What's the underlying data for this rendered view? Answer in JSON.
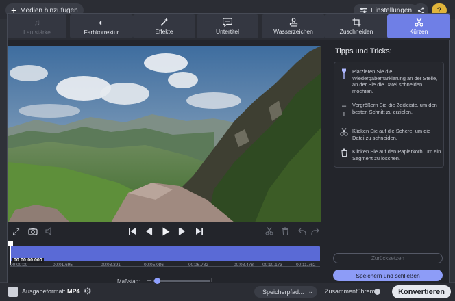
{
  "main_window": {
    "add_media_label": "Medien hinzufügen",
    "settings_label": "Einstellungen",
    "help_label": "?",
    "output_format_label": "Ausgabeformat:",
    "output_format_value": "MP4",
    "save_path_label": "Speicherpfad...",
    "merge_label": "Zusammenführen:",
    "convert_label": "Konvertieren"
  },
  "tabs": [
    {
      "label": "Lautstärke",
      "icon": "music-note-icon",
      "state": "disabled"
    },
    {
      "label": "Farbkorrektur",
      "icon": "color-correction-icon",
      "state": "normal"
    },
    {
      "label": "Effekte",
      "icon": "magic-wand-icon",
      "state": "normal"
    },
    {
      "label": "Untertitel",
      "icon": "subtitle-icon",
      "state": "normal"
    },
    {
      "label": "Wasserzeichen",
      "icon": "stamp-icon",
      "state": "normal"
    },
    {
      "label": "Zuschneiden",
      "icon": "crop-icon",
      "state": "normal"
    },
    {
      "label": "Kürzen",
      "icon": "scissors-icon",
      "state": "active"
    }
  ],
  "timeline": {
    "current_time": "00:00:00.000",
    "ticks": [
      "00:00:00",
      "00:01.695",
      "00:03.391",
      "00:05.086",
      "00:06.782",
      "00:08.478",
      "00:10.173",
      "00:11.762"
    ],
    "scale_label": "Maßstab:",
    "scale_minus": "–",
    "scale_plus": "+",
    "scale_level": 0.02
  },
  "tips": {
    "title": "Tipps und Tricks:",
    "items": [
      {
        "icon": "marker-icon",
        "text": "Platzieren Sie die Wiedergabemarkierung an der Stelle, an der Sie die Datei schneiden möchten."
      },
      {
        "icon": "zoom-timeline-icon",
        "text": "Vergrößern Sie die Zeitleiste, um den besten Schnitt zu erzielen."
      },
      {
        "icon": "scissors-icon",
        "text": "Klicken Sie auf die Schere, um die Datei zu schneiden."
      },
      {
        "icon": "trash-icon",
        "text": "Klicken Sie auf den Papierkorb, um ein Segment zu löschen."
      }
    ]
  },
  "buttons": {
    "reset_label": "Zurücksetzen",
    "save_close_label": "Speichern und schließen"
  },
  "colors": {
    "accent": "#6f7fe6",
    "timeline": "#5a6ad6",
    "save_button": "#8d9cf7"
  }
}
